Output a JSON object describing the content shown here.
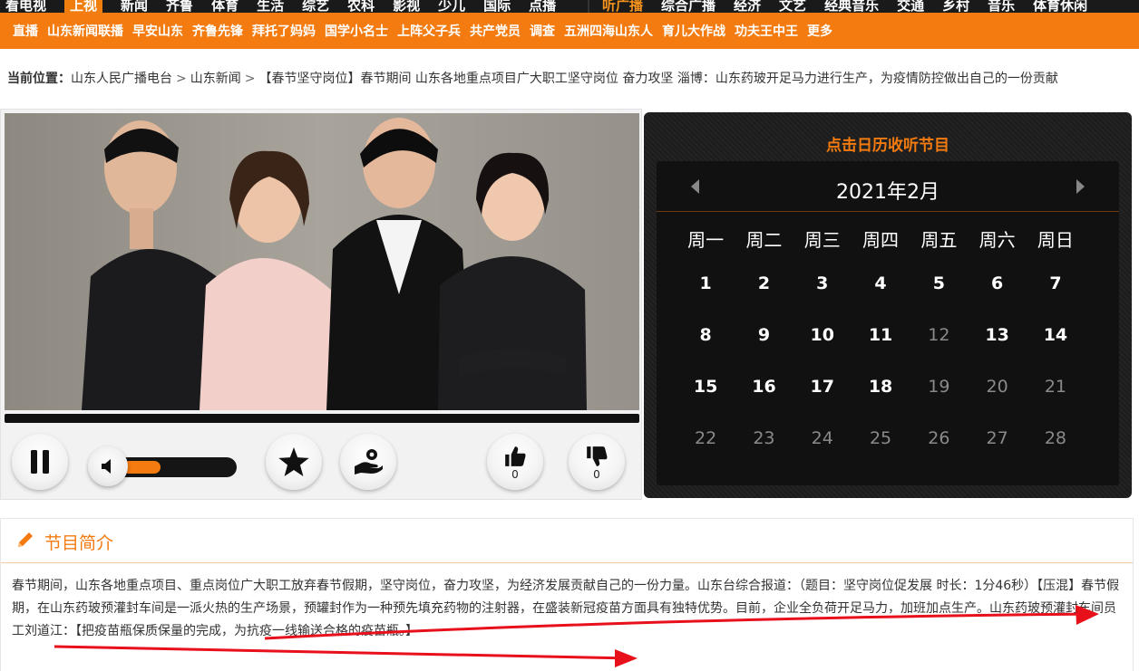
{
  "top_nav": {
    "left_items": [
      "看电视",
      "上视",
      "新闻",
      "齐鲁",
      "体育",
      "生活",
      "综艺",
      "农科",
      "影视",
      "少儿",
      "国际",
      "点播"
    ],
    "right_items": [
      "听广播",
      "综合广播",
      "经济",
      "文艺",
      "经典音乐",
      "交通",
      "乡村",
      "音乐",
      "体育休闲"
    ]
  },
  "sub_nav": {
    "items": [
      "直播",
      "山东新闻联播",
      "早安山东",
      "齐鲁先锋",
      "拜托了妈妈",
      "国学小名士",
      "上阵父子兵",
      "共产党员",
      "调查",
      "五洲四海山东人",
      "育儿大作战",
      "功夫王中王",
      "更多"
    ]
  },
  "breadcrumb": {
    "label": "当前位置：",
    "items": [
      "山东人民广播电台",
      "山东新闻"
    ],
    "separator": ">",
    "current": "【春节坚守岗位】春节期间 山东各地重点项目广大职工坚守岗位 奋力攻坚 淄博：山东药玻开足马力进行生产，为疫情防控做出自己的一份贡献"
  },
  "player": {
    "like_count": "0",
    "dislike_count": "0",
    "volume": 0.32,
    "progress": 0.0,
    "icons": {
      "pause": "pause-icon",
      "volume": "speaker-icon",
      "favorite": "star-icon",
      "donate": "hand-coin-icon",
      "like": "thumbs-up-icon",
      "dislike": "thumbs-down-icon"
    }
  },
  "calendar": {
    "title": "点击日历收听节目",
    "month": "2021年2月",
    "weekdays": [
      "周一",
      "周二",
      "周三",
      "周四",
      "周五",
      "周六",
      "周日"
    ],
    "weeks": [
      [
        {
          "d": "1",
          "on": true
        },
        {
          "d": "2",
          "on": true
        },
        {
          "d": "3",
          "on": true
        },
        {
          "d": "4",
          "on": true
        },
        {
          "d": "5",
          "on": true
        },
        {
          "d": "6",
          "on": true
        },
        {
          "d": "7",
          "on": true
        }
      ],
      [
        {
          "d": "8",
          "on": true
        },
        {
          "d": "9",
          "on": true
        },
        {
          "d": "10",
          "on": true
        },
        {
          "d": "11",
          "on": true
        },
        {
          "d": "12",
          "on": false
        },
        {
          "d": "13",
          "on": true
        },
        {
          "d": "14",
          "on": true
        }
      ],
      [
        {
          "d": "15",
          "on": true
        },
        {
          "d": "16",
          "on": true
        },
        {
          "d": "17",
          "on": true
        },
        {
          "d": "18",
          "on": true
        },
        {
          "d": "19",
          "on": false
        },
        {
          "d": "20",
          "on": false
        },
        {
          "d": "21",
          "on": false
        }
      ],
      [
        {
          "d": "22",
          "on": false
        },
        {
          "d": "23",
          "on": false
        },
        {
          "d": "24",
          "on": false
        },
        {
          "d": "25",
          "on": false
        },
        {
          "d": "26",
          "on": false
        },
        {
          "d": "27",
          "on": false
        },
        {
          "d": "28",
          "on": false
        }
      ]
    ]
  },
  "intro": {
    "title": "节目简介",
    "text": "春节期间，山东各地重点项目、重点岗位广大职工放弃春节假期，坚守岗位，奋力攻坚，为经济发展贡献自己的一份力量。山东台综合报道：（题目：坚守岗位促发展 时长：1分46秒）【压混】春节假期，在山东药玻预灌封车间是一派火热的生产场景，预罐封作为一种预先填充药物的注射器，在盛装新冠疫苗方面具有独特优势。目前，企业全负荷开足马力，加班加点生产。山东药玻预灌封车间员工刘道江：【把疫苗瓶保质保量的完成，为抗疫一线输送合格的疫苗瓶。】"
  },
  "colors": {
    "accent": "#f37b10",
    "annotation": "#e8101a"
  }
}
